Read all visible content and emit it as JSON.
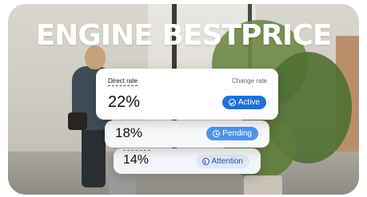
{
  "headline": "ENGINE BESTPRICE",
  "table": {
    "column_left": "Direct rate",
    "column_right": "Change rate",
    "rows": [
      {
        "rate": "22%",
        "status": "Active",
        "status_icon": "check-circle-icon",
        "color": "#1f6fd6"
      },
      {
        "rate": "18%",
        "status": "Pending",
        "status_icon": "clock-icon",
        "color": "#4d95e8"
      },
      {
        "rate": "14%",
        "status": "Attention",
        "status_icon": "info-icon",
        "color": "#dfe8f7"
      }
    ]
  }
}
